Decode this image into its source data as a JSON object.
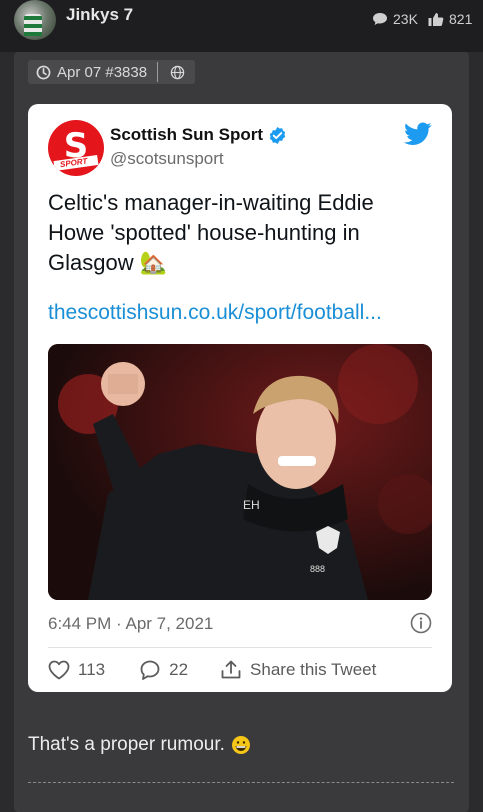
{
  "header": {
    "username": "Jinkys 7",
    "views": "23K",
    "likes": "821"
  },
  "post": {
    "date_id": "Apr 07 #3838",
    "comment": "That's a proper rumour."
  },
  "tweet": {
    "author_name": "Scottish Sun Sport",
    "handle": "@scotsunsport",
    "logo_text": "SPORT",
    "text": "Celtic's manager-in-waiting Eddie Howe 'spotted' house-hunting in Glasgow 🏡",
    "link": "thescottishsun.co.uk/sport/football...",
    "timestamp": "6:44 PM · Apr 7, 2021",
    "likes": "113",
    "replies": "22",
    "share_label": "Share this Tweet"
  },
  "colors": {
    "page_bg": "#2b2b2d",
    "post_bg": "#3a3a3c",
    "link": "#1b8fd6",
    "verified": "#1d9bf0",
    "twitter_bird": "#1d9bf0",
    "logo_red": "#e4161c"
  },
  "icons": {
    "views": "speech-bubble-icon",
    "likes": "thumbs-up-icon",
    "clock": "clock-icon",
    "globe": "globe-icon",
    "verified": "verified-badge-icon",
    "twitter": "twitter-bird-icon",
    "info": "info-icon",
    "heart": "heart-icon",
    "reply": "reply-icon",
    "share": "share-icon",
    "emoji": "grinning-face-icon"
  }
}
